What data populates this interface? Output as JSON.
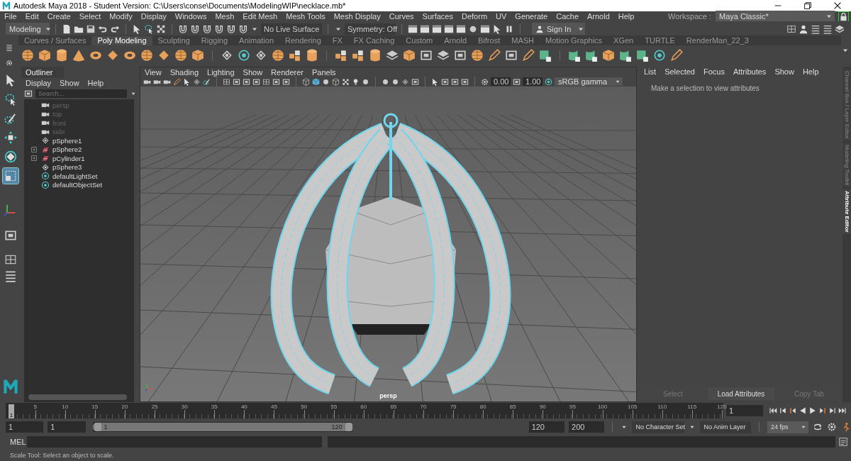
{
  "window": {
    "title": "Autodesk Maya 2018 - Student Version: C:\\Users\\conse\\Documents\\ModelingWIP\\necklace.mb*"
  },
  "menu_bar": [
    "File",
    "Edit",
    "Create",
    "Select",
    "Modify",
    "Display",
    "Windows",
    "Mesh",
    "Edit Mesh",
    "Mesh Tools",
    "Mesh Display",
    "Curves",
    "Surfaces",
    "Deform",
    "UV",
    "Generate",
    "Cache",
    "Arnold",
    "Help"
  ],
  "workspace": {
    "label": "Workspace :",
    "value": "Maya Classic*"
  },
  "status_line": {
    "menu_set": "Modeling",
    "live_surface": "No Live Surface",
    "symmetry": "Symmetry: Off",
    "sign_in": "Sign In"
  },
  "shelf": {
    "tabs": [
      {
        "label": "Curves / Surfaces",
        "selected": false
      },
      {
        "label": "Poly Modeling",
        "selected": true
      },
      {
        "label": "Sculpting",
        "selected": false
      },
      {
        "label": "Rigging",
        "selected": false
      },
      {
        "label": "Animation",
        "selected": false
      },
      {
        "label": "Rendering",
        "selected": false
      },
      {
        "label": "FX",
        "selected": false
      },
      {
        "label": "FX Caching",
        "selected": false
      },
      {
        "label": "Custom",
        "selected": false
      },
      {
        "label": "Arnold",
        "selected": false
      },
      {
        "label": "Bifrost",
        "selected": false
      },
      {
        "label": "MASH",
        "selected": false
      },
      {
        "label": "Motion Graphics",
        "selected": false
      },
      {
        "label": "XGen",
        "selected": false
      },
      {
        "label": "TURTLE",
        "selected": false
      },
      {
        "label": "RenderMan_22_3",
        "selected": false
      }
    ]
  },
  "toolbox": {
    "tools": [
      {
        "kind": "select",
        "selected": false
      },
      {
        "kind": "lasso",
        "selected": false
      },
      {
        "kind": "paint",
        "selected": false
      },
      {
        "kind": "move",
        "selected": false
      },
      {
        "kind": "rotate",
        "selected": false
      },
      {
        "kind": "scale",
        "selected": true
      }
    ]
  },
  "outliner": {
    "title": "Outliner",
    "menu": [
      "Display",
      "Show",
      "Help"
    ],
    "search": {
      "placeholder": "Search..."
    },
    "items": [
      {
        "label": "persp",
        "kind": "camera",
        "dimmed": true,
        "expandable": false
      },
      {
        "label": "top",
        "kind": "camera",
        "dimmed": true,
        "expandable": false
      },
      {
        "label": "front",
        "kind": "camera",
        "dimmed": true,
        "expandable": false
      },
      {
        "label": "side",
        "kind": "camera",
        "dimmed": true,
        "expandable": false
      },
      {
        "label": "pSphere1",
        "kind": "transform",
        "dimmed": false,
        "expandable": false
      },
      {
        "label": "pSphere2",
        "kind": "group",
        "dimmed": false,
        "expandable": true
      },
      {
        "label": "pCylinder1",
        "kind": "group",
        "dimmed": false,
        "expandable": true
      },
      {
        "label": "pSphere3",
        "kind": "transform",
        "dimmed": false,
        "expandable": false
      },
      {
        "label": "defaultLightSet",
        "kind": "set",
        "dimmed": false,
        "expandable": false
      },
      {
        "label": "defaultObjectSet",
        "kind": "set",
        "dimmed": false,
        "expandable": false
      }
    ]
  },
  "viewport": {
    "menu": [
      "View",
      "Shading",
      "Lighting",
      "Show",
      "Renderer",
      "Panels"
    ],
    "exposure": "0.00",
    "gamma": "1.00",
    "color_space": "sRGB gamma",
    "camera_label": "persp"
  },
  "attribute_editor": {
    "menu": [
      "List",
      "Selected",
      "Focus",
      "Attributes",
      "Show",
      "Help"
    ],
    "message": "Make a selection to view attributes",
    "buttons": [
      {
        "label": "Select",
        "disabled": true
      },
      {
        "label": "Load Attributes",
        "disabled": false
      },
      {
        "label": "Copy Tab",
        "disabled": true
      }
    ]
  },
  "side_tabs": [
    {
      "label": "Channel Box / Layer Editor",
      "selected": false
    },
    {
      "label": "Modeling Toolkit",
      "selected": false
    },
    {
      "label": "Attribute Editor",
      "selected": true
    }
  ],
  "time_slider": {
    "ticks": [
      "5",
      "10",
      "15",
      "20",
      "25",
      "30",
      "35",
      "40",
      "45",
      "50",
      "55",
      "60",
      "65",
      "70",
      "75",
      "80",
      "85",
      "90",
      "95",
      "100",
      "105",
      "110",
      "115",
      "120"
    ],
    "current_frame": "1",
    "frame_field": "1"
  },
  "range_slider": {
    "start": "1",
    "playback_start": "1",
    "range_start": "1",
    "range_end": "120",
    "playback_end": "120",
    "end": "200",
    "character_set": "No Character Set",
    "anim_layer": "No Anim Layer",
    "fps": "24 fps"
  },
  "command_line": {
    "language": "MEL"
  },
  "help_line": "Scale Tool: Select an object to scale."
}
